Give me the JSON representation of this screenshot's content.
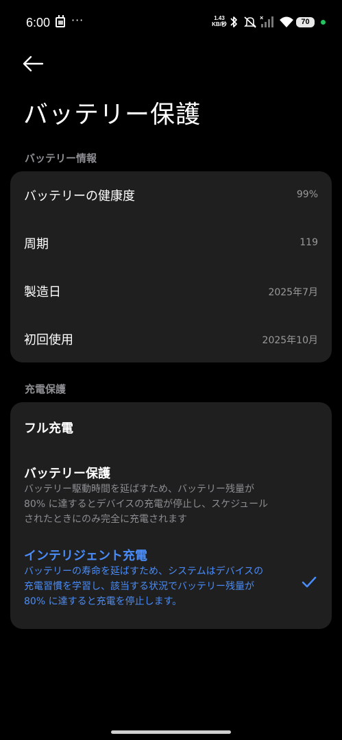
{
  "status_bar": {
    "time": "6:00",
    "more": "···",
    "net_speed_value": "1.43",
    "net_speed_unit": "KB/秒",
    "battery_level": "70"
  },
  "header": {
    "title": "バッテリー保護"
  },
  "battery_info": {
    "section_label": "バッテリー情報",
    "rows": [
      {
        "label": "バッテリーの健康度",
        "value": "99%"
      },
      {
        "label": "周期",
        "value": "119"
      },
      {
        "label": "製造日",
        "value": "2025年7月"
      },
      {
        "label": "初回使用",
        "value": "2025年10月"
      }
    ]
  },
  "charge_protection": {
    "section_label": "充電保護",
    "options": [
      {
        "title": "フル充電",
        "desc": ""
      },
      {
        "title": "バッテリー保護",
        "desc_lines": [
          "バッテリー駆動時間を延ばすため、バッテリー残量が",
          "80% に達するとデバイスの充電が停止し、スケジュール",
          "されたときにのみ完全に充電されます"
        ]
      },
      {
        "title": "インテリジェント充電",
        "desc_lines": [
          "バッテリーの寿命を延ばすため、システムはデバイスの",
          "充電習慣を学習し、該当する状況でバッテリー残量が",
          "80% に達すると充電を停止します。"
        ],
        "selected": true
      }
    ]
  },
  "colors": {
    "accent": "#4a8cf7",
    "card_bg": "#1f1f1f",
    "secondary_text": "#8e8e93"
  }
}
